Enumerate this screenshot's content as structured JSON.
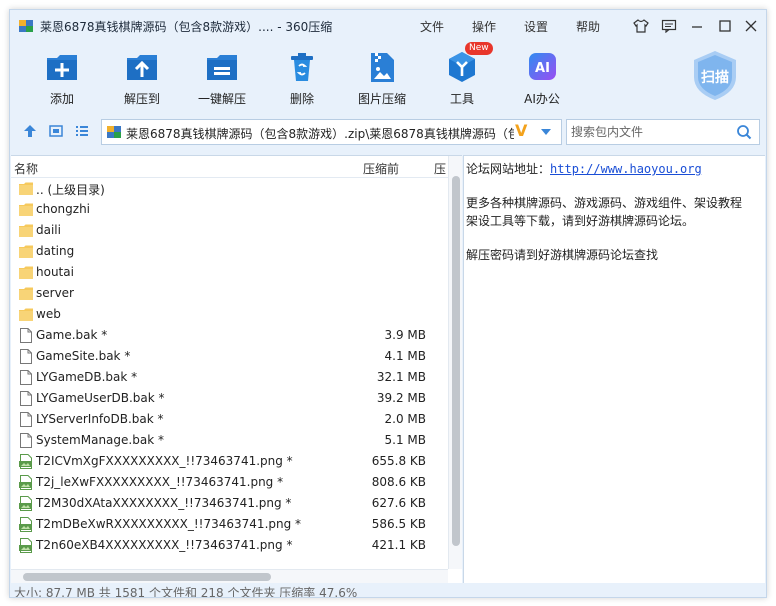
{
  "title": "莱恩6878真钱棋牌源码（包含8款游戏）.... - 360压缩",
  "menu": [
    "文件",
    "操作",
    "设置",
    "帮助"
  ],
  "toolbar": [
    {
      "icon": "add-icon",
      "label": "添加"
    },
    {
      "icon": "extract-to-icon",
      "label": "解压到"
    },
    {
      "icon": "one-click-extract-icon",
      "label": "一键解压"
    },
    {
      "icon": "delete-icon",
      "label": "删除"
    },
    {
      "icon": "image-compress-icon",
      "label": "图片压缩"
    },
    {
      "icon": "tools-icon",
      "label": "工具"
    },
    {
      "icon": "ai-office-icon",
      "label": "AI办公"
    }
  ],
  "new_badge": "New",
  "scan_label": "扫描",
  "path": "莱恩6878真钱棋牌源码（包含8款游戏）.zip\\莱恩6878真钱棋牌源码（包",
  "search": {
    "placeholder": "搜索包内文件",
    "value": ""
  },
  "columns": {
    "name": "名称",
    "size": "压缩前",
    "extra": "压"
  },
  "files": [
    {
      "type": "folder",
      "name": ".. (上级目录)",
      "size": ""
    },
    {
      "type": "folder",
      "name": "chongzhi",
      "size": ""
    },
    {
      "type": "folder",
      "name": "daili",
      "size": ""
    },
    {
      "type": "folder",
      "name": "dating",
      "size": ""
    },
    {
      "type": "folder",
      "name": "houtai",
      "size": ""
    },
    {
      "type": "folder",
      "name": "server",
      "size": ""
    },
    {
      "type": "folder",
      "name": "web",
      "size": ""
    },
    {
      "type": "file",
      "name": "Game.bak *",
      "size": "3.9 MB"
    },
    {
      "type": "file",
      "name": "GameSite.bak *",
      "size": "4.1 MB"
    },
    {
      "type": "file",
      "name": "LYGameDB.bak *",
      "size": "32.1 MB"
    },
    {
      "type": "file",
      "name": "LYGameUserDB.bak *",
      "size": "39.2 MB"
    },
    {
      "type": "file",
      "name": "LYServerInfoDB.bak *",
      "size": "2.0 MB"
    },
    {
      "type": "file",
      "name": "SystemManage.bak *",
      "size": "5.1 MB"
    },
    {
      "type": "png",
      "name": "T2ICVmXgFXXXXXXXXX_!!73463741.png *",
      "size": "655.8 KB"
    },
    {
      "type": "png",
      "name": "T2j_leXwFXXXXXXXXX_!!73463741.png *",
      "size": "808.6 KB"
    },
    {
      "type": "png",
      "name": "T2M30dXAtaXXXXXXXX_!!73463741.png *",
      "size": "627.6 KB"
    },
    {
      "type": "png",
      "name": "T2mDBeXwRXXXXXXXXX_!!73463741.png *",
      "size": "586.5 KB"
    },
    {
      "type": "png",
      "name": "T2n60eXB4XXXXXXXXX_!!73463741.png *",
      "size": "421.1 KB"
    }
  ],
  "info": {
    "site_label": "论坛网站地址：",
    "site_url": "http://www.haoyou.org",
    "line2": "更多各种棋牌源码、游戏源码、游戏组件、架设教程",
    "line3": "架设工具等下载，请到好游棋牌源码论坛。",
    "line4": "解压密码请到好游棋牌源码论坛查找"
  },
  "status": "大小: 87.7 MB 共 1581 个文件和 218 个文件夹 压缩率 47.6%"
}
